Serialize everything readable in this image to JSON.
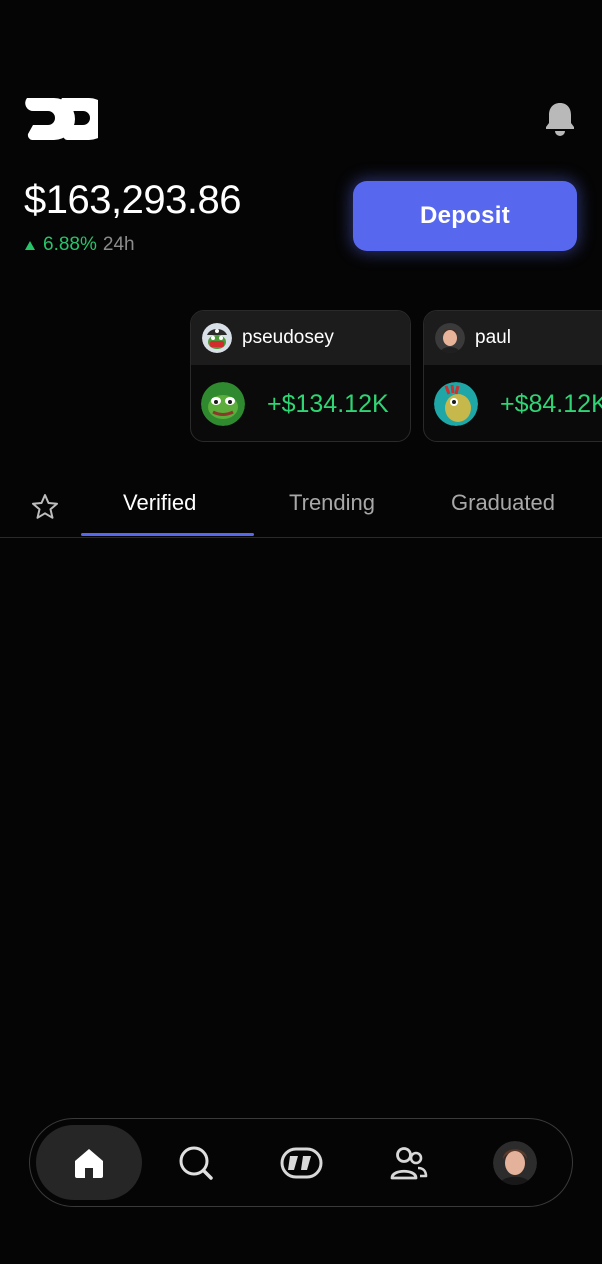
{
  "header": {
    "logo_icon": "brand-logo-icon",
    "notifications_icon": "bell-icon"
  },
  "portfolio": {
    "balance": "$163,293.86",
    "change_pct": "6.88%",
    "change_period": "24h",
    "change_direction": "up",
    "positive_color": "#27c46a"
  },
  "deposit": {
    "label": "Deposit",
    "color": "#5868ee"
  },
  "traders": [
    {
      "username": "pseudosey",
      "profit": "+$134.12K",
      "avatar_icon": "pirate-frog-avatar",
      "token_icon": "pepe-token-icon"
    },
    {
      "username": "paul",
      "profit": "+$84.12K",
      "avatar_icon": "person-avatar",
      "token_icon": "bird-token-icon"
    }
  ],
  "tabs": {
    "favorites_icon": "star-icon",
    "items": [
      "Verified",
      "Trending",
      "Graduated"
    ],
    "active": "Verified"
  },
  "bottom_nav": {
    "items": [
      "home-icon",
      "search-icon",
      "brand-logo-icon",
      "people-icon",
      "profile-avatar"
    ],
    "active": "home-icon"
  }
}
